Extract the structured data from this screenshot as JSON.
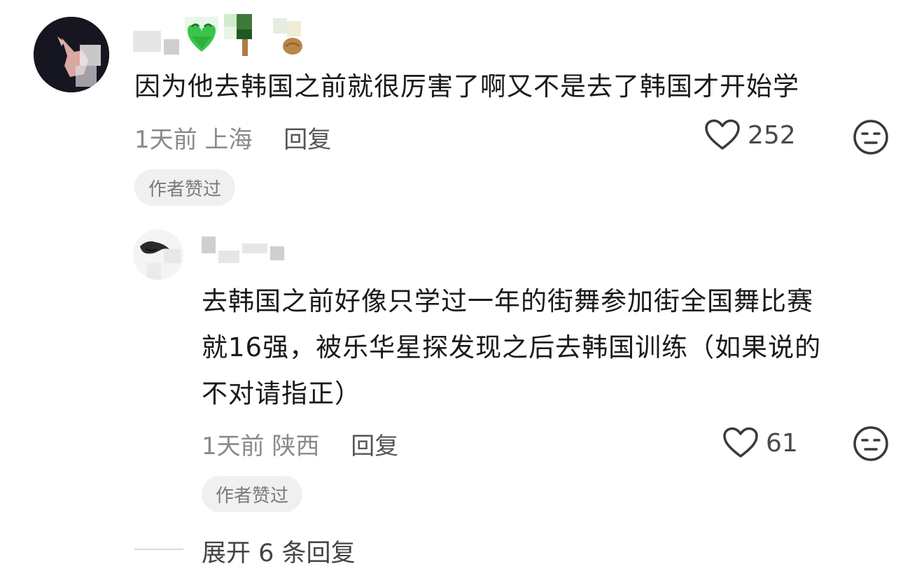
{
  "main_comment": {
    "text": "因为他去韩国之前就很厉害了啊又不是去了韩国才开始学",
    "time": "1天前",
    "location": "上海",
    "reply_label": "回复",
    "likes": "252",
    "badge": "作者赞过"
  },
  "reply_comment": {
    "text": "去韩国之前好像只学过一年的街舞参加街全国舞比赛就16强，被乐华星探发现之后去韩国训练（如果说的不对请指正）",
    "lines": [
      "去韩国之前好像只学过一年的街舞参加街全国舞比赛",
      "就16强，被乐华星探发现之后去韩国训练（如果说的",
      "不对请指正）"
    ],
    "time": "1天前",
    "location": "陕西",
    "reply_label": "回复",
    "likes": "61",
    "badge": "作者赞过"
  },
  "expand": {
    "label": "展开 6 条回复"
  },
  "colors": {
    "text_primary": "#1a1a1a",
    "text_meta": "#8a8a8a",
    "badge_bg": "#f0f0f0",
    "emoji_green": "#3cc44a"
  },
  "icons": {
    "like": "heart-outline-icon",
    "dislike": "meh-face-icon",
    "main_username_emojis": [
      "green-heart-face-emoji",
      "pixel-tree-emoji",
      "walnut-emoji"
    ]
  }
}
